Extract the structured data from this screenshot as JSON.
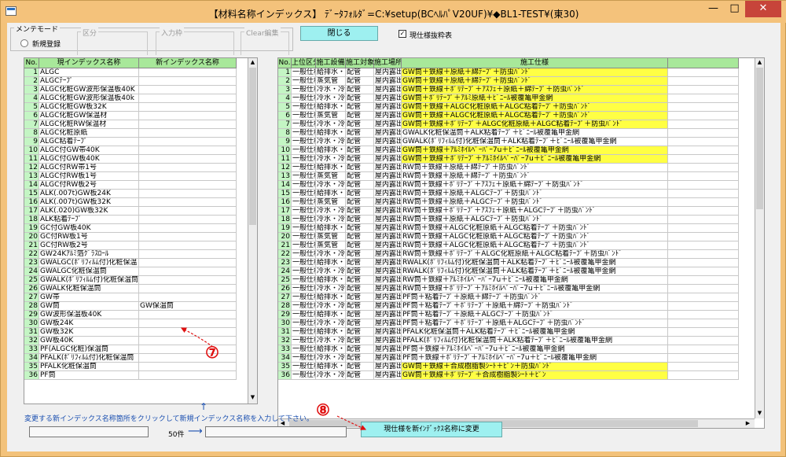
{
  "window": {
    "title": "【材料名称インデックス】 ﾃﾞｰﾀﾌｫﾙﾀﾞ=C:¥setup(BCﾍﾙﾊﾟV20UF)¥◆BL1-TEST¥(東30)",
    "min": "—",
    "max": "□",
    "close": "✕"
  },
  "mode": {
    "group_label": "メンテモード",
    "radio_label": "新規登録",
    "sub1": "区分",
    "sub2": "入力枠",
    "sub3": "Clear編集"
  },
  "close_button": "閉じる",
  "checkbox": {
    "label": "現仕様抜粋表",
    "checked": "✓"
  },
  "left_table": {
    "headers": [
      "No.",
      "現インデックス名称",
      "新インデックス名称"
    ],
    "rows": [
      [
        "1",
        "ALGC",
        ""
      ],
      [
        "2",
        "ALGCﾃｰﾌﾟ",
        ""
      ],
      [
        "3",
        "ALGC化粧GW波形保温板40K",
        ""
      ],
      [
        "4",
        "ALGC化粧GW波形保温板40k",
        ""
      ],
      [
        "5",
        "ALGC化粧GW板32K",
        ""
      ],
      [
        "6",
        "ALGC化粧GW保温材",
        ""
      ],
      [
        "7",
        "ALGC化粧RW保温材",
        ""
      ],
      [
        "8",
        "ALGC化粧原紙",
        ""
      ],
      [
        "9",
        "ALGC粘着ﾃｰﾌﾟ",
        ""
      ],
      [
        "10",
        "ALGC付GW帯40K",
        ""
      ],
      [
        "11",
        "ALGC付GW板40K",
        ""
      ],
      [
        "12",
        "ALGC付RW帯1号",
        ""
      ],
      [
        "13",
        "ALGC付RW板1号",
        ""
      ],
      [
        "14",
        "ALGC付RW板2号",
        ""
      ],
      [
        "15",
        "ALK(.007t)GW板24K",
        ""
      ],
      [
        "16",
        "ALK(.007t)GW板32K",
        ""
      ],
      [
        "17",
        "ALK(.020)GW板32K",
        ""
      ],
      [
        "18",
        "ALK粘着ﾃｰﾌﾟ",
        ""
      ],
      [
        "19",
        "GC付GW板40K",
        ""
      ],
      [
        "20",
        "GC付RW板1号",
        ""
      ],
      [
        "21",
        "GC付RW板2号",
        ""
      ],
      [
        "22",
        "GW24Kｱﾙﾐ箔ｸﾞﾗｽﾛｰﾙ",
        ""
      ],
      [
        "23",
        "GWALGC(ﾎﾟﾘﾌｨﾙﾑ付)化粧保温",
        ""
      ],
      [
        "24",
        "GWALGC化粧保温筒",
        ""
      ],
      [
        "25",
        "GWALK(ﾎﾟﾘﾌｨﾙﾑ付)化粧保温筒",
        ""
      ],
      [
        "26",
        "GWALK化粧保温筒",
        ""
      ],
      [
        "27",
        "GW帯",
        ""
      ],
      [
        "28",
        "GW筒",
        "GW保温筒"
      ],
      [
        "29",
        "GW波形保温板40K",
        ""
      ],
      [
        "30",
        "GW板24K",
        ""
      ],
      [
        "31",
        "GW板32K",
        ""
      ],
      [
        "32",
        "GW板40K",
        ""
      ],
      [
        "33",
        "PF(ALGC化粧)保温筒",
        ""
      ],
      [
        "34",
        "PFALK(ﾎﾟﾘﾌｨﾙﾑ付)化粧保温筒",
        ""
      ],
      [
        "35",
        "PFALK化粧保温筒",
        ""
      ],
      [
        "36",
        "PF筒",
        ""
      ]
    ]
  },
  "right_table": {
    "headers": [
      "No.",
      "上位区分",
      "施工設備",
      "施工対象",
      "施工場所",
      "施工仕様"
    ],
    "rows": [
      [
        "1",
        "一般仕様",
        "給排水・衛",
        "配管",
        "屋内露出",
        "GW筒＋鉄線＋原紙＋綿ﾃｰﾌﾟ＋防虫ﾊﾞﾝﾄﾞ",
        "y"
      ],
      [
        "2",
        "一般仕様",
        "蒸気管",
        "配管",
        "屋内露出",
        "GW筒＋鉄線＋原紙＋綿ﾃｰﾌﾟ＋防虫ﾊﾞﾝﾄﾞ",
        "y"
      ],
      [
        "3",
        "一般仕様",
        "冷水・冷温",
        "配管",
        "屋内露出",
        "GW筒＋鉄線＋ﾎﾟﾘﾃｰﾌﾟ＋ｱｽﾌｪ＋原紙＋綿ﾃｰﾌﾟ＋防虫ﾊﾞﾝﾄﾞ",
        "y"
      ],
      [
        "4",
        "一般仕様",
        "冷水・冷温",
        "配管",
        "屋内露出",
        "GW筒＋ﾎﾟﾘﾃｰﾌﾟ＋ｱﾙﾐ原紙＋ﾋﾞﾆｰﾙ被覆亀甲金網",
        "y"
      ],
      [
        "5",
        "一般仕様",
        "給排水・衛",
        "配管",
        "屋内露出",
        "GW筒＋鉄線＋ALGC化粧原紙＋ALGC粘着ﾃｰﾌﾟ＋防虫ﾊﾞﾝﾄﾞ",
        "y"
      ],
      [
        "6",
        "一般仕様",
        "蒸気管",
        "配管",
        "屋内露出",
        "GW筒＋鉄線＋ALGC化粧原紙＋ALGC粘着ﾃｰﾌﾟ＋防虫ﾊﾞﾝﾄﾞ",
        "y"
      ],
      [
        "7",
        "一般仕様",
        "冷水・冷温",
        "配管",
        "屋内露出",
        "GW筒＋鉄線＋ﾎﾟﾘﾃｰﾌﾟ＋ALGC化粧原紙＋ALGC粘着ﾃｰﾌﾟ＋防虫ﾊﾞﾝﾄﾞ",
        "y"
      ],
      [
        "8",
        "一般仕様",
        "給排水・衛",
        "配管",
        "屋内露出",
        "GWALK化粧保温筒＋ALK粘着ﾃｰﾌﾟ＋ﾋﾞﾆｰﾙ被覆亀甲金網",
        "n"
      ],
      [
        "9",
        "一般仕様",
        "冷水・冷温",
        "配管",
        "屋内露出",
        "GWALK(ﾎﾟﾘﾌｨﾙﾑ付)化粧保温筒＋ALK粘着ﾃｰﾌﾟ＋ﾋﾞﾆｰﾙ被覆亀甲金網",
        "n"
      ],
      [
        "10",
        "一般仕様",
        "給排水・衛",
        "配管",
        "屋内露出",
        "GW筒＋鉄線＋ｱﾙﾐﾎｲﾙﾍﾟｰﾊﾟｰ7u＋ﾋﾞﾆｰﾙ被覆亀甲金網",
        "y"
      ],
      [
        "11",
        "一般仕様",
        "冷水・冷温",
        "配管",
        "屋内露出",
        "GW筒＋鉄線＋ﾎﾟﾘﾃｰﾌﾟ＋ｱﾙﾐﾎｲﾙﾍﾟｰﾊﾟｰ7u＋ﾋﾞﾆｰﾙ被覆亀甲金網",
        "y"
      ],
      [
        "12",
        "一般仕様",
        "給排水・衛",
        "配管",
        "屋内露出",
        "RW筒＋鉄線＋原紙＋綿ﾃｰﾌﾟ＋防虫ﾊﾞﾝﾄﾞ",
        "n"
      ],
      [
        "13",
        "一般仕様",
        "蒸気管",
        "配管",
        "屋内露出",
        "RW筒＋鉄線＋原紙＋綿ﾃｰﾌﾟ＋防虫ﾊﾞﾝﾄﾞ",
        "n"
      ],
      [
        "14",
        "一般仕様",
        "冷水・冷温",
        "配管",
        "屋内露出",
        "RW筒＋鉄線＋ﾎﾟﾘﾃｰﾌﾟ＋ｱｽﾌｪ＋原紙＋綿ﾃｰﾌﾟ＋防虫ﾊﾞﾝﾄﾞ",
        "n"
      ],
      [
        "15",
        "一般仕様",
        "給排水・衛",
        "配管",
        "屋内露出",
        "RW筒＋鉄線＋原紙＋ALGCﾃｰﾌﾟ＋防虫ﾊﾞﾝﾄﾞ",
        "n"
      ],
      [
        "16",
        "一般仕様",
        "蒸気管",
        "配管",
        "屋内露出",
        "RW筒＋鉄線＋原紙＋ALGCﾃｰﾌﾟ＋防虫ﾊﾞﾝﾄﾞ",
        "n"
      ],
      [
        "17",
        "一般仕様",
        "冷水・冷温",
        "配管",
        "屋内露出",
        "RW筒＋鉄線＋ﾎﾟﾘﾃｰﾌﾟ＋ｱｽﾌｪ＋原紙＋ALGCﾃｰﾌﾟ＋防虫ﾊﾞﾝﾄﾞ",
        "n"
      ],
      [
        "18",
        "一般仕様",
        "冷水・冷温",
        "配管",
        "屋内露出",
        "RW筒＋鉄線＋原紙＋ALGCﾃｰﾌﾟ＋防虫ﾊﾞﾝﾄﾞ",
        "n"
      ],
      [
        "19",
        "一般仕様",
        "給排水・衛",
        "配管",
        "屋内露出",
        "RW筒＋鉄線＋ALGC化粧原紙＋ALGC粘着ﾃｰﾌﾟ＋防虫ﾊﾞﾝﾄﾞ",
        "n"
      ],
      [
        "20",
        "一般仕様",
        "蒸気管",
        "配管",
        "屋内露出",
        "RW筒＋鉄線＋ALGC化粧原紙＋ALGC粘着ﾃｰﾌﾟ＋防虫ﾊﾞﾝﾄﾞ",
        "n"
      ],
      [
        "21",
        "一般仕様",
        "蒸気管",
        "配管",
        "屋内露出",
        "RW筒＋鉄線＋ALGC化粧原紙＋ALGC粘着ﾃｰﾌﾟ＋防虫ﾊﾞﾝﾄﾞ",
        "n"
      ],
      [
        "22",
        "一般仕様",
        "冷水・冷温",
        "配管",
        "屋内露出",
        "RW筒＋鉄線＋ﾎﾟﾘﾃｰﾌﾟ＋ALGC化粧原紙＋ALGC粘着ﾃｰﾌﾟ＋防虫ﾊﾞﾝﾄﾞ",
        "n"
      ],
      [
        "23",
        "一般仕様",
        "給排水・衛",
        "配管",
        "屋内露出",
        "RWALK(ﾎﾟﾘﾌｨﾙﾑ付)化粧保温筒＋ALK粘着ﾃｰﾌﾟ＋ﾋﾞﾆｰﾙ被覆亀甲金網",
        "n"
      ],
      [
        "24",
        "一般仕様",
        "冷水・冷温",
        "配管",
        "屋内露出",
        "RWALK(ﾎﾟﾘﾌｨﾙﾑ付)化粧保温筒＋ALK粘着ﾃｰﾌﾟ＋ﾋﾞﾆｰﾙ被覆亀甲金網",
        "n"
      ],
      [
        "25",
        "一般仕様",
        "給排水・衛",
        "配管",
        "屋内露出",
        "RW筒＋鉄線＋ｱﾙﾐﾎｲﾙﾍﾟｰﾊﾟｰ7u＋ﾋﾞﾆｰﾙ被覆亀甲金網",
        "n"
      ],
      [
        "26",
        "一般仕様",
        "冷水・冷温",
        "配管",
        "屋内露出",
        "RW筒＋鉄線＋ﾎﾟﾘﾃｰﾌﾟ＋ｱﾙﾐﾎｲﾙﾍﾟｰﾊﾟｰ7u＋ﾋﾞﾆｰﾙ被覆亀甲金網",
        "n"
      ],
      [
        "27",
        "一般仕様",
        "給排水・衛",
        "配管",
        "屋内露出",
        "PF筒＋粘着ﾃｰﾌﾟ＋原紙＋綿ﾃｰﾌﾟ＋防虫ﾊﾞﾝﾄﾞ",
        "n"
      ],
      [
        "28",
        "一般仕様",
        "冷水・冷温",
        "配管",
        "屋内露出",
        "PF筒＋粘着ﾃｰﾌﾟ＋ﾎﾟﾘﾃｰﾌﾟ＋原紙＋綿ﾃｰﾌﾟ＋防虫ﾊﾞﾝﾄﾞ",
        "n"
      ],
      [
        "29",
        "一般仕様",
        "給排水・衛",
        "配管",
        "屋内露出",
        "PF筒＋粘着ﾃｰﾌﾟ＋原紙＋ALGCﾃｰﾌﾟ＋防虫ﾊﾞﾝﾄﾞ",
        "n"
      ],
      [
        "30",
        "一般仕様",
        "冷水・冷温",
        "配管",
        "屋内露出",
        "PF筒＋粘着ﾃｰﾌﾟ＋ﾎﾟﾘﾃｰﾌﾟ＋原紙＋ALGCﾃｰﾌﾟ＋防虫ﾊﾞﾝﾄﾞ",
        "n"
      ],
      [
        "31",
        "一般仕様",
        "給排水・衛",
        "配管",
        "屋内露出",
        "PFALK化粧保温筒＋ALK粘着ﾃｰﾌﾟ＋ﾋﾞﾆｰﾙ被覆亀甲金網",
        "n"
      ],
      [
        "32",
        "一般仕様",
        "冷水・冷温",
        "配管",
        "屋内露出",
        "PFALK(ﾎﾟﾘﾌｨﾙﾑ付)化粧保温筒＋ALK粘着ﾃｰﾌﾟ＋ﾋﾞﾆｰﾙ被覆亀甲金網",
        "n"
      ],
      [
        "33",
        "一般仕様",
        "給排水・衛",
        "配管",
        "屋内露出",
        "PF筒＋鉄線＋ｱﾙﾐﾎｲﾙﾍﾟｰﾊﾟｰ7u＋ﾋﾞﾆｰﾙ被覆亀甲金網",
        "n"
      ],
      [
        "34",
        "一般仕様",
        "冷水・冷温",
        "配管",
        "屋内露出",
        "PF筒＋鉄線＋ﾎﾟﾘﾃｰﾌﾟ＋ｱﾙﾐﾎｲﾙﾍﾟｰﾊﾟｰ7u＋ﾋﾞﾆｰﾙ被覆亀甲金網",
        "n"
      ],
      [
        "35",
        "一般仕様",
        "給排水・衛",
        "配管",
        "屋内露出",
        "GW筒＋鉄線＋合成樹脂製ｼｰﾄ＋ﾋﾟﾝ＋防虫ﾊﾞﾝﾄﾞ",
        "y"
      ],
      [
        "36",
        "一般仕様",
        "冷水・冷温",
        "配管",
        "屋内露出",
        "GW筒＋鉄線＋ﾎﾟﾘﾃｰﾌﾟ＋合成樹脂製ｼｰﾄ＋ﾋﾟﾝ",
        "y"
      ]
    ]
  },
  "instruction": "変更する新インデックス名称箇所をクリックして新規インデックス名称を入力して下さい。",
  "count": "50件",
  "change_button": "現仕様を新ｲﾝﾃﾞｯｸｽ名称に変更",
  "markers": {
    "m7": "⑦",
    "m8": "⑧"
  },
  "arrows": {
    "up": "↑",
    "right": "⟶"
  },
  "colors": {
    "highlight": "#ffff44",
    "header": "#a8e89a",
    "button": "#9ef0f0",
    "annotation": "#e01010"
  }
}
